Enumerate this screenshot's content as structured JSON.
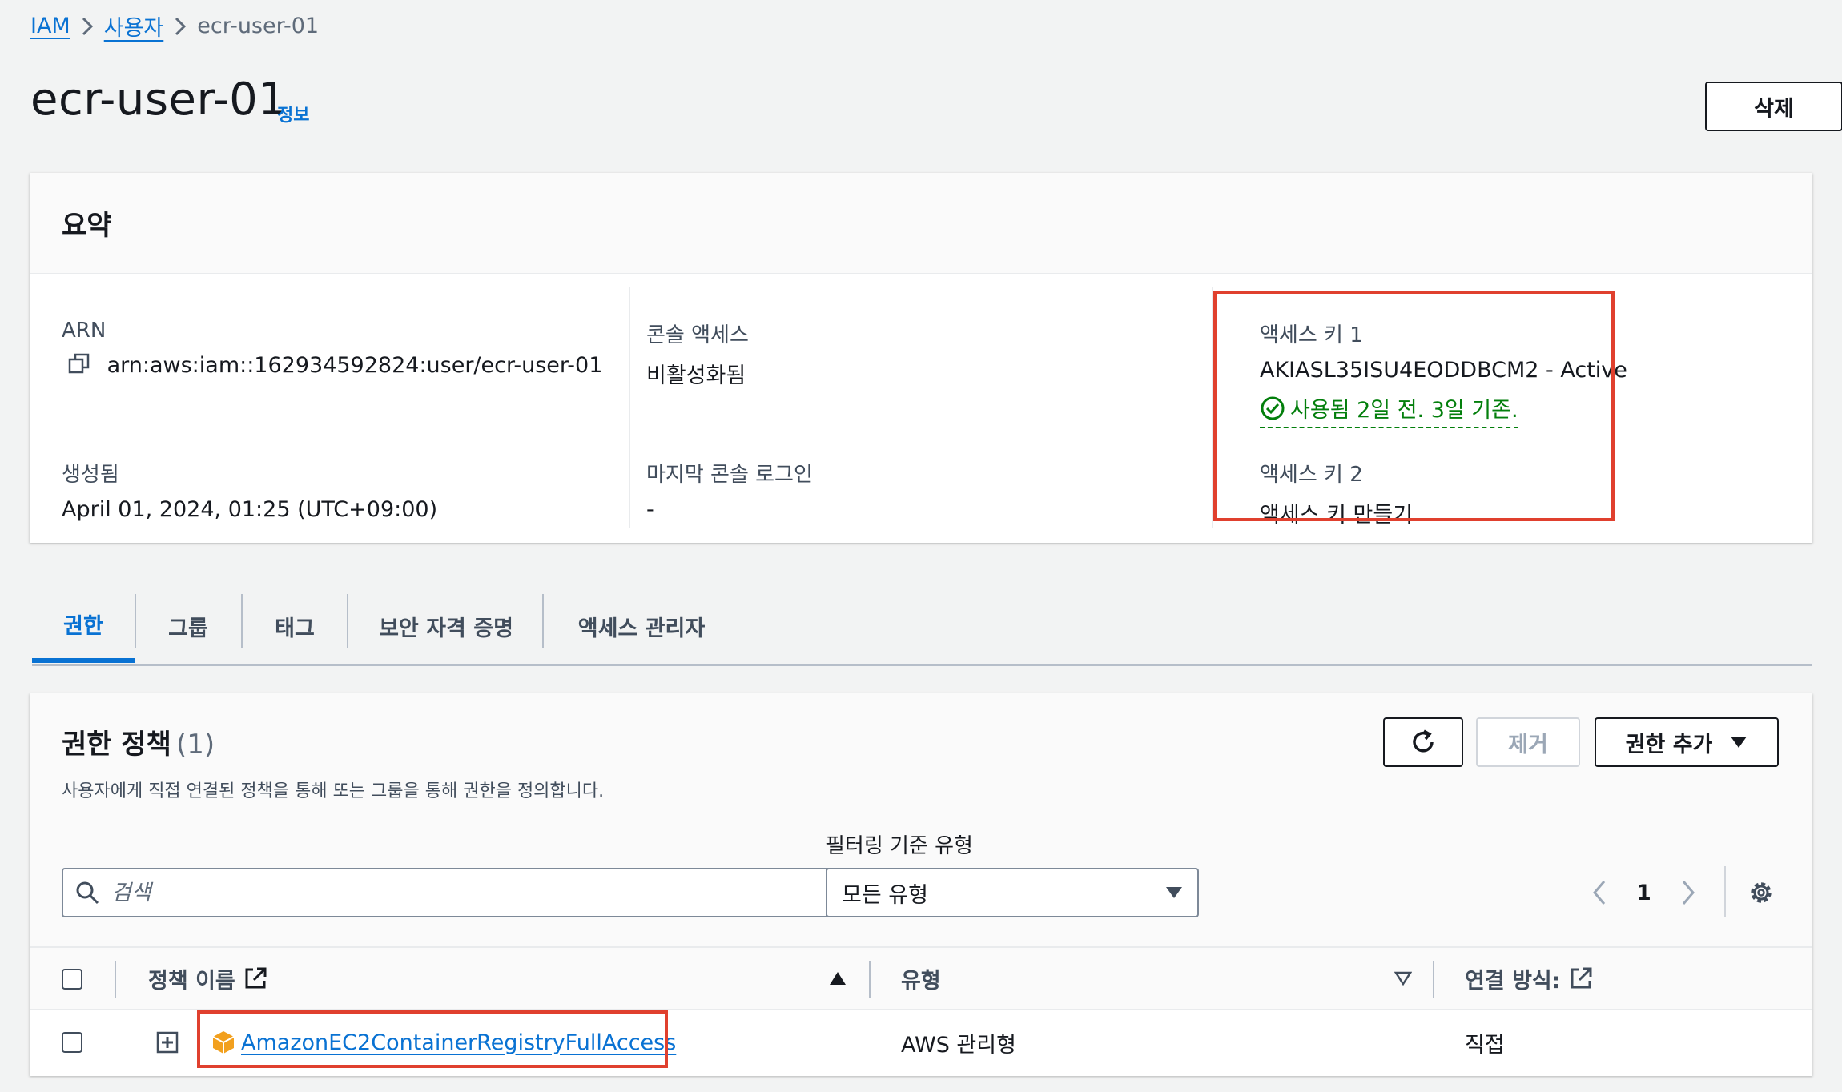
{
  "breadcrumb": {
    "root": "IAM",
    "users": "사용자",
    "current": "ecr-user-01"
  },
  "header": {
    "title": "ecr-user-01",
    "info": "정보",
    "delete_label": "삭제"
  },
  "summary": {
    "title": "요약",
    "arn_label": "ARN",
    "arn_value": "arn:aws:iam::162934592824:user/ecr-user-01",
    "created_label": "생성됨",
    "created_value": "April 01, 2024, 01:25 (UTC+09:00)",
    "console_access_label": "콘솔 액세스",
    "console_access_value": "비활성화됨",
    "last_console_login_label": "마지막 콘솔 로그인",
    "last_console_login_value": "-",
    "access_key1_label": "액세스 키 1",
    "access_key1_value": "AKIASL35ISU4EODDBCM2 - Active",
    "access_key1_status": "사용됨 2일 전. 3일 기존.",
    "access_key2_label": "액세스 키 2",
    "access_key2_link": "액세스 키 만들기"
  },
  "tabs": [
    {
      "label": "권한",
      "active": true
    },
    {
      "label": "그룹",
      "active": false
    },
    {
      "label": "태그",
      "active": false
    },
    {
      "label": "보안 자격 증명",
      "active": false
    },
    {
      "label": "액세스 관리자",
      "active": false
    }
  ],
  "permissions": {
    "title": "권한 정책",
    "count": "(1)",
    "description": "사용자에게 직접 연결된 정책을 통해 또는 그룹을 통해 권한을 정의합니다.",
    "remove_label": "제거",
    "add_label": "권한 추가",
    "filter_label": "필터링 기준 유형",
    "search_placeholder": "검색",
    "filter_value": "모든 유형",
    "page": "1",
    "columns": {
      "name": "정책 이름",
      "type": "유형",
      "attached": "연결 방식:"
    },
    "rows": [
      {
        "name": "AmazonEC2ContainerRegistryFullAccess",
        "type": "AWS 관리형",
        "attached": "직접"
      }
    ]
  },
  "colors": {
    "link": "#0972d3",
    "success": "#037f0c",
    "highlight": "#e0402e",
    "policy_icon": "#f2a01e"
  }
}
